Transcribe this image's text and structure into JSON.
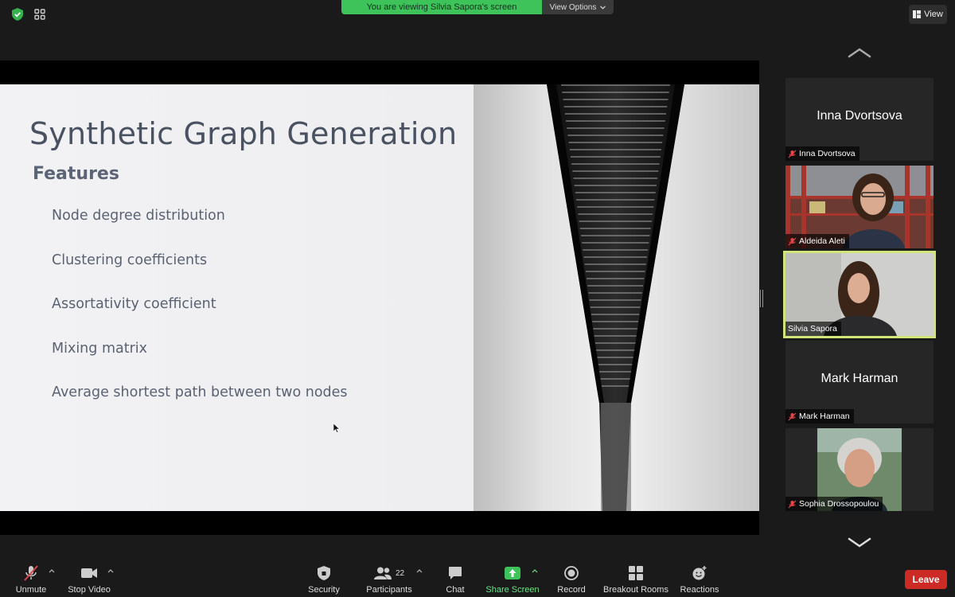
{
  "top_bar": {
    "banner_text": "You are viewing Silvia Sapora's screen",
    "view_options_label": "View Options",
    "view_label": "View",
    "banner_color": "#3dc35a"
  },
  "slide": {
    "title": "Synthetic Graph Generation",
    "subtitle": "Features",
    "features": [
      "Node degree distribution",
      "Clustering coefficients",
      "Assortativity coefficient",
      "Mixing matrix",
      "Average shortest path between two nodes"
    ]
  },
  "participants_gallery": [
    {
      "name": "Inna Dvortsova",
      "video": false,
      "muted": true,
      "active": false
    },
    {
      "name": "Aldeida Aleti",
      "video": true,
      "muted": true,
      "active": false
    },
    {
      "name": "Silvia Sapora",
      "video": true,
      "muted": false,
      "active": true
    },
    {
      "name": "Mark Harman",
      "video": false,
      "muted": true,
      "active": false
    },
    {
      "name": "Sophia Drossopoulou",
      "video": true,
      "muted": true,
      "active": false
    }
  ],
  "toolbar": {
    "unmute": "Unmute",
    "stop_video": "Stop Video",
    "security": "Security",
    "participants": "Participants",
    "participants_count": "22",
    "chat": "Chat",
    "share_screen": "Share Screen",
    "record": "Record",
    "breakout_rooms": "Breakout Rooms",
    "reactions": "Reactions",
    "leave": "Leave",
    "share_color": "#3dc35a",
    "leave_color": "#cc2a24"
  }
}
